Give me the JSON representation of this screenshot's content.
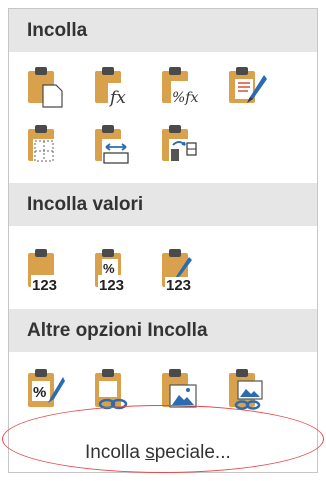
{
  "sections": {
    "paste": {
      "title": "Incolla",
      "icons": [
        "paste-icon",
        "paste-formulas-icon",
        "paste-formulas-number-formatting-icon",
        "keep-source-formatting-icon",
        "no-borders-icon",
        "transpose-icon",
        "keep-source-column-widths-icon"
      ]
    },
    "paste_values": {
      "title": "Incolla valori",
      "icons": [
        "paste-values-icon",
        "values-number-formatting-icon",
        "values-source-formatting-icon"
      ],
      "icon_text": "123",
      "percent": "%"
    },
    "other_paste": {
      "title": "Altre opzioni Incolla",
      "icons": [
        "paste-formatting-icon",
        "paste-link-icon",
        "paste-picture-icon",
        "linked-picture-icon"
      ]
    }
  },
  "special": {
    "label_prefix": "Incolla ",
    "label_underlined": "s",
    "label_suffix": "peciale..."
  },
  "colors": {
    "clipboard": "#d9a14b",
    "clip": "#4a4a4a",
    "header_bg": "#e6e6e6",
    "blue": "#2b6cb0",
    "ellipse": "#e5484d"
  },
  "glyphs": {
    "fx": "fx",
    "percent_fx": "%fx"
  }
}
